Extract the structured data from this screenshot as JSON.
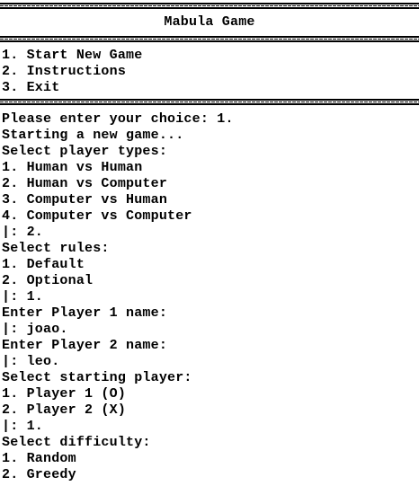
{
  "window": {
    "title": "Mabula Game"
  },
  "main_menu": {
    "items": [
      "1. Start New Game",
      "2. Instructions",
      "3. Exit"
    ]
  },
  "session": {
    "lines": [
      "Please enter your choice: 1.",
      "Starting a new game...",
      "Select player types:",
      "1. Human vs Human",
      "2. Human vs Computer",
      "3. Computer vs Human",
      "4. Computer vs Computer",
      "|: 2.",
      "Select rules:",
      "1. Default",
      "2. Optional",
      "|: 1.",
      "Enter Player 1 name:",
      "|: joao.",
      "Enter Player 2 name:",
      "|: leo.",
      "Select starting player:",
      "1. Player 1 (O)",
      "2. Player 2 (X)",
      "|: 1.",
      "Select difficulty:",
      "1. Random",
      "2. Greedy"
    ]
  }
}
